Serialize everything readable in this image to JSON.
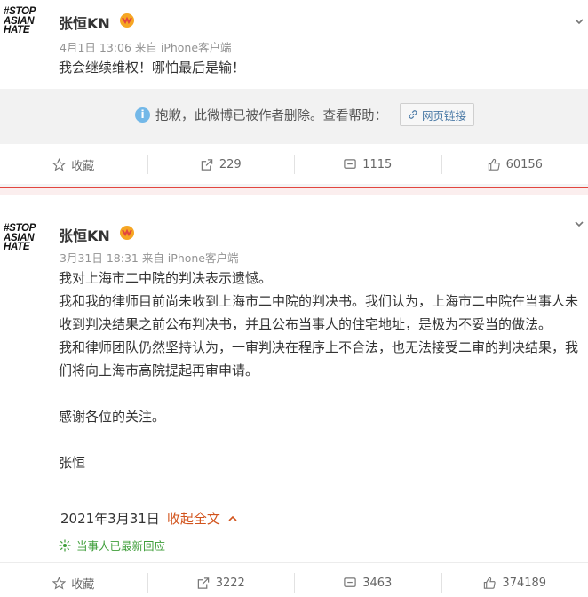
{
  "posts": [
    {
      "avatar_text": [
        "#STOP",
        "ASIAN",
        "HATE"
      ],
      "author": "张恒KN",
      "meta": "4月1日 13:06 来自 iPhone客户端",
      "content": "我会继续维权！哪怕最后是输！",
      "deleted_notice": "抱歉，此微博已被作者删除。查看帮助：",
      "deleted_link": "网页链接",
      "actions": {
        "fav": "收藏",
        "repost": "229",
        "comment": "1115",
        "like": "60156"
      }
    },
    {
      "avatar_text": [
        "#STOP",
        "ASIAN",
        "HATE"
      ],
      "author": "张恒KN",
      "meta": "3月31日 18:31 来自 iPhone客户端",
      "paragraphs": [
        "我对上海市二中院的判决表示遗憾。",
        "我和我的律师目前尚未收到上海市二中院的判决书。我们认为，上海市二中院在当事人未收到判决结果之前公布判决书，并且公布当事人的住宅地址，是极为不妥当的做法。",
        "我和律师团队仍然坚持认为，一审判决在程序上不合法，也无法接受二审的判决结果，我们将向上海市高院提起再审申请。",
        "",
        "感谢各位的关注。",
        "",
        "张恒"
      ],
      "date_line": "2021年3月31日",
      "collapse": "收起全文",
      "tip": "当事人已最新回应",
      "actions": {
        "fav": "收藏",
        "repost": "3222",
        "comment": "3463",
        "like": "374189"
      }
    }
  ],
  "colors": {
    "accent": "#d2541d",
    "divider": "#e2463f",
    "tip": "#3f9e3a"
  }
}
